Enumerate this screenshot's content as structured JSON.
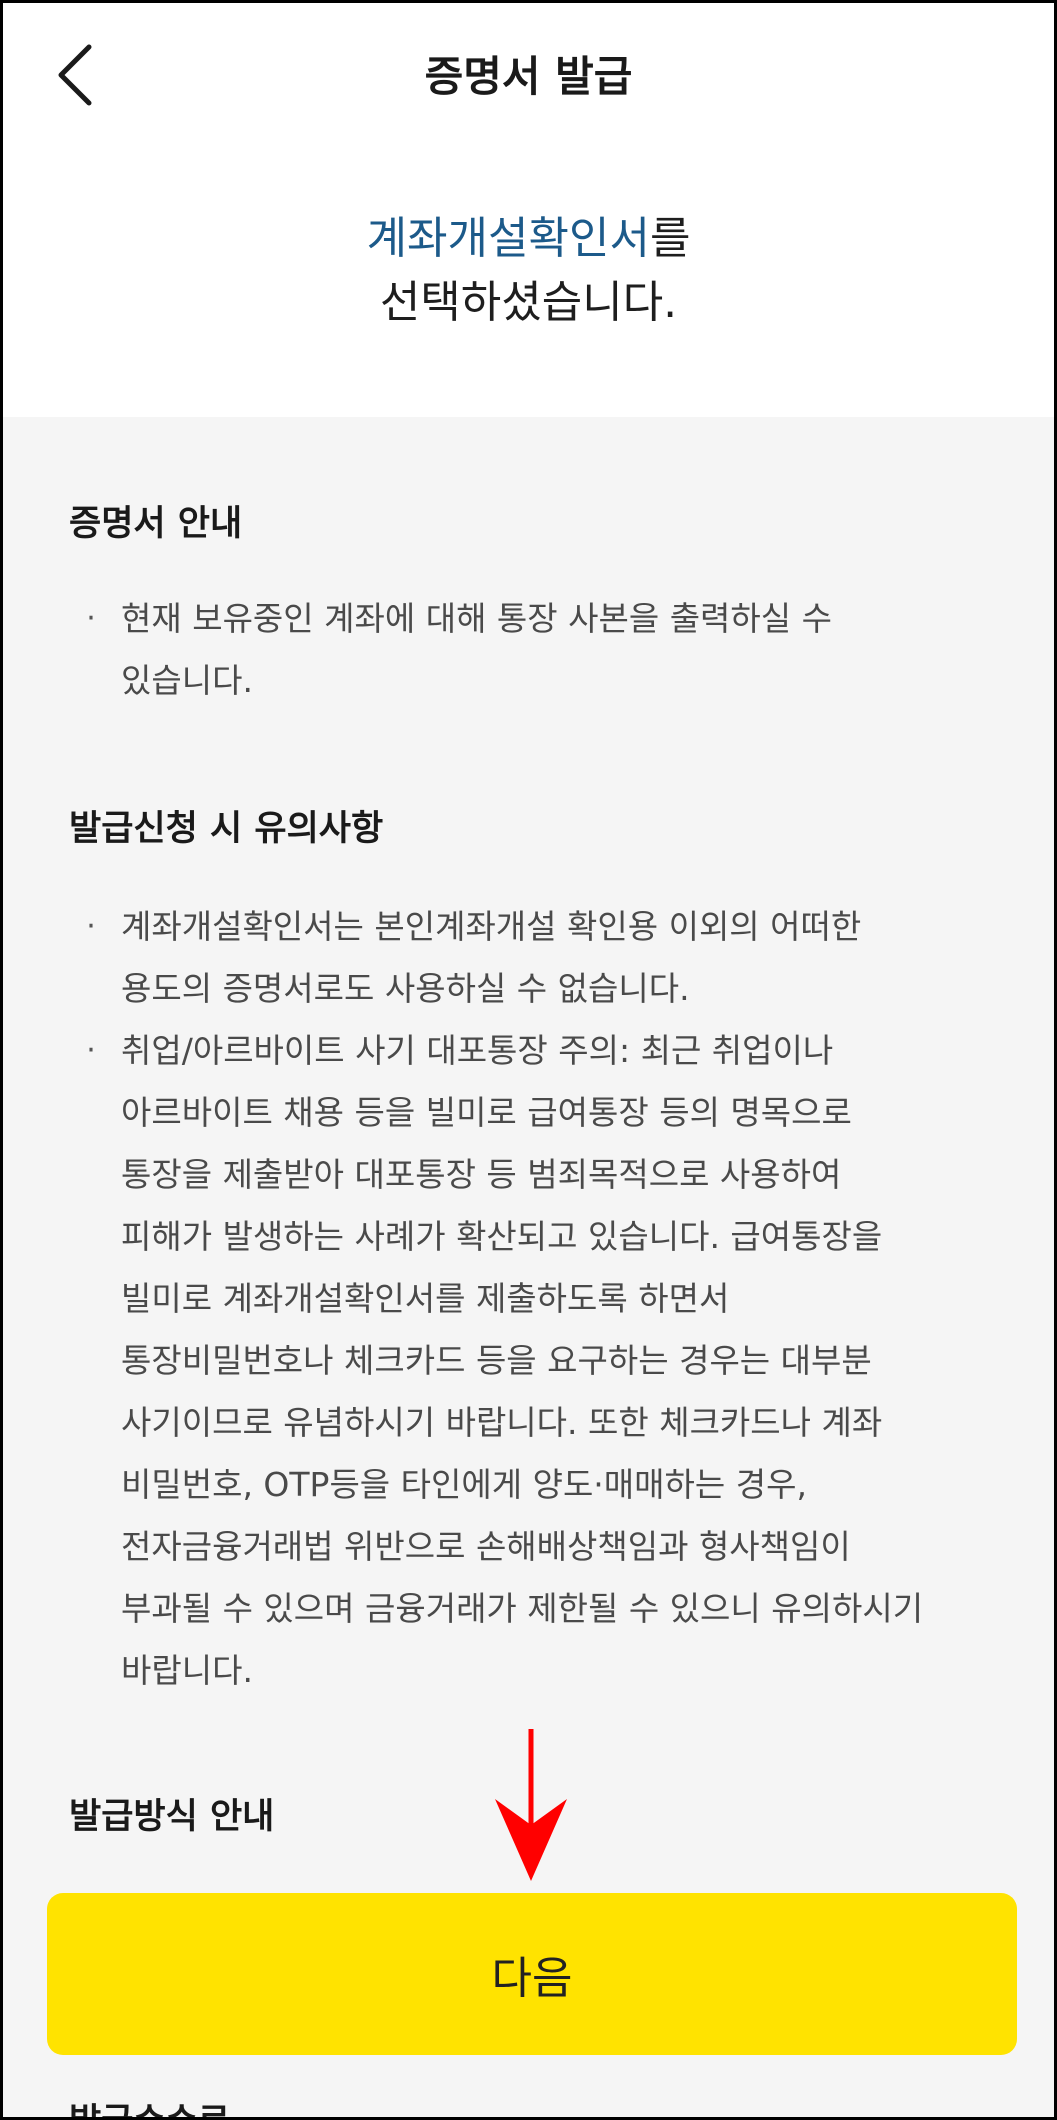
{
  "header": {
    "title": "증명서 발급",
    "back_icon": "chevron-left-icon"
  },
  "hero": {
    "selected_name": "계좌개설확인서",
    "particle": "를",
    "line2": "선택하셨습니다.",
    "accent_color": "#1c5a8a"
  },
  "sections": {
    "info": {
      "title": "증명서 안내",
      "bullet1": [
        "현재 보유중인 계좌에 대해 통장 사본을 출력하실 수",
        "있습니다."
      ]
    },
    "caution": {
      "title": "발급신청 시 유의사항",
      "bullet1": [
        "계좌개설확인서는 본인계좌개설 확인용 이외의 어떠한",
        "용도의 증명서로도 사용하실 수 없습니다."
      ],
      "bullet2": [
        "취업/아르바이트 사기 대포통장 주의: 최근 취업이나",
        "아르바이트 채용 등을 빌미로 급여통장 등의 명목으로",
        "통장을 제출받아 대포통장 등 범죄목적으로 사용하여",
        "피해가 발생하는 사례가 확산되고 있습니다. 급여통장을",
        "빌미로 계좌개설확인서를 제출하도록 하면서",
        "통장비밀번호나 체크카드 등을 요구하는 경우는 대부분",
        "사기이므로 유념하시기 바랍니다. 또한 체크카드나 계좌",
        "비밀번호, OTP등을 타인에게 양도·매매하는 경우,",
        "전자금융거래법 위반으로 손해배상책임과 형사책임이",
        "부과될 수 있으며 금융거래가 제한될 수 있으니 유의하시기",
        "바랍니다."
      ]
    },
    "method": {
      "title": "발급방식 안내"
    },
    "fee": {
      "title": "발급수수료"
    }
  },
  "bullet_char": "·",
  "next_button": {
    "label": "다음",
    "color": "#ffe300"
  },
  "annotation": {
    "arrow_color": "#ff0000"
  }
}
